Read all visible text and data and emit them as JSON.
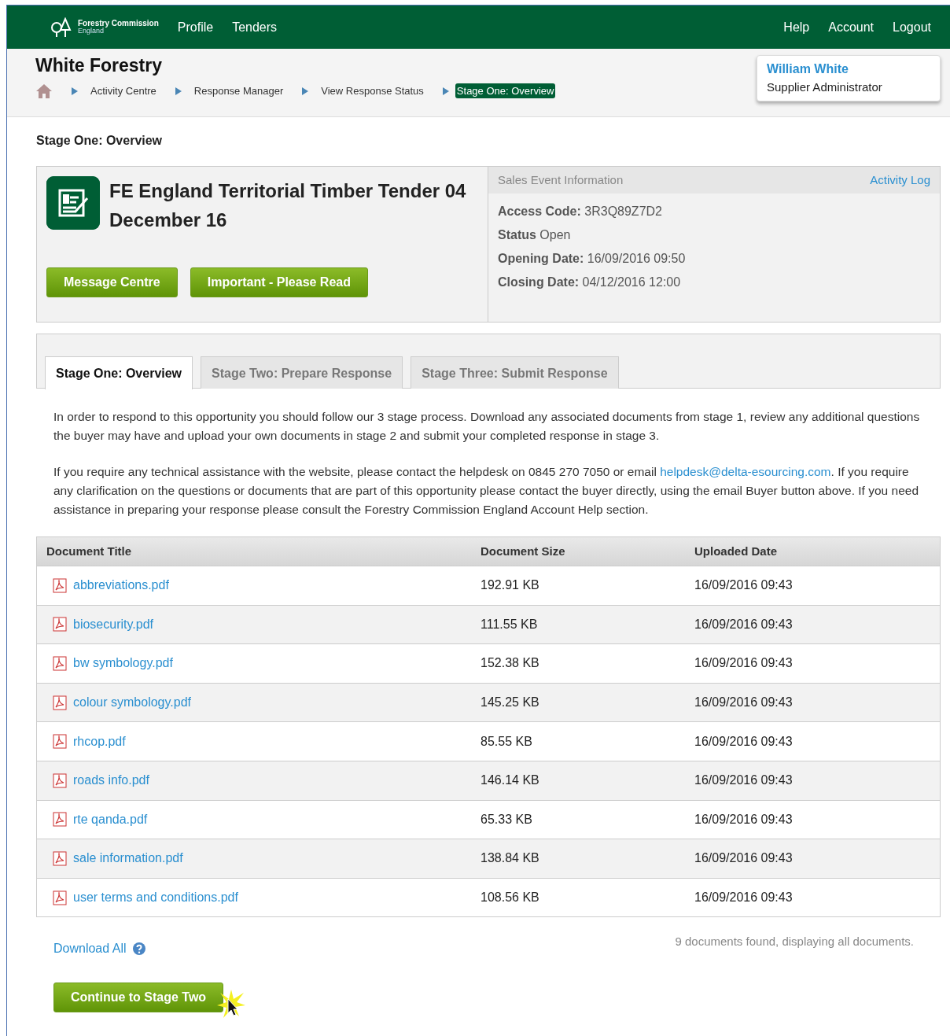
{
  "header": {
    "logo": {
      "line1": "Forestry Commission",
      "line2": "England"
    },
    "nav_left": [
      "Profile",
      "Tenders"
    ],
    "nav_right": [
      "Help",
      "Account",
      "Logout"
    ]
  },
  "company": "White Forestry",
  "breadcrumb": [
    {
      "label": "Activity Centre",
      "selected": false
    },
    {
      "label": "Response Manager",
      "selected": false
    },
    {
      "label": "View Response Status",
      "selected": false
    },
    {
      "label": "Stage One: Overview",
      "selected": true
    }
  ],
  "user": {
    "name": "William White",
    "role": "Supplier Administrator"
  },
  "page_title": "Stage One: Overview",
  "event": {
    "title": "FE England Territorial Timber Tender 04 December 16",
    "buttons": [
      "Message Centre",
      "Important - Please Read"
    ]
  },
  "sales_info": {
    "heading": "Sales Event Information",
    "link": "Activity Log",
    "fields": [
      "**Access Code:** 3R3Q89Z7D2",
      "**Status** Open",
      "**Opening Date:** 16/09/2016 09:50",
      "**Closing Date:** 04/12/2016 12:00"
    ]
  },
  "tabs": [
    {
      "label": "Stage One: Overview",
      "selected": true
    },
    {
      "label": "Stage Two: Prepare Response",
      "selected": false
    },
    {
      "label": "Stage Three: Submit Response",
      "selected": false
    }
  ],
  "intro": "In order to respond to this opportunity you should follow our 3 stage process. Download any associated documents from stage 1, review any additional questions the buyer may have and upload your own documents in stage 2 and submit your completed response in stage 3.",
  "help_text": {
    "before": "If you require any technical assistance with the website, please contact the helpdesk on 0845 270 7050 or email ",
    "link": "helpdesk@delta-esourcing.com",
    "after": ". If you require any clarification on the questions or documents that are part of this opportunity please contact the buyer directly, using the email Buyer button above. If you need assistance in preparing your response please consult the Forestry Commission England Account Help section."
  },
  "table": {
    "columns": [
      "Document Title",
      "Document Size",
      "Uploaded Date"
    ],
    "rows": [
      [
        "abbreviations.pdf",
        "192.91 KB",
        "16/09/2016 09:43"
      ],
      [
        "biosecurity.pdf",
        "111.55 KB",
        "16/09/2016 09:43"
      ],
      [
        "bw symbology.pdf",
        "152.38 KB",
        "16/09/2016 09:43"
      ],
      [
        "colour symbology.pdf",
        "145.25 KB",
        "16/09/2016 09:43"
      ],
      [
        "rhcop.pdf",
        "85.55 KB",
        "16/09/2016 09:43"
      ],
      [
        "roads info.pdf",
        "146.14 KB",
        "16/09/2016 09:43"
      ],
      [
        "rte qanda.pdf",
        "65.33 KB",
        "16/09/2016 09:43"
      ],
      [
        "sale information.pdf",
        "138.84 KB",
        "16/09/2016 09:43"
      ],
      [
        "user terms and conditions.pdf",
        "108.56 KB",
        "16/09/2016 09:43"
      ]
    ]
  },
  "download_all": "Download All",
  "summary": "9 documents found, displaying all documents.",
  "continue_button": "Continue to Stage Two"
}
